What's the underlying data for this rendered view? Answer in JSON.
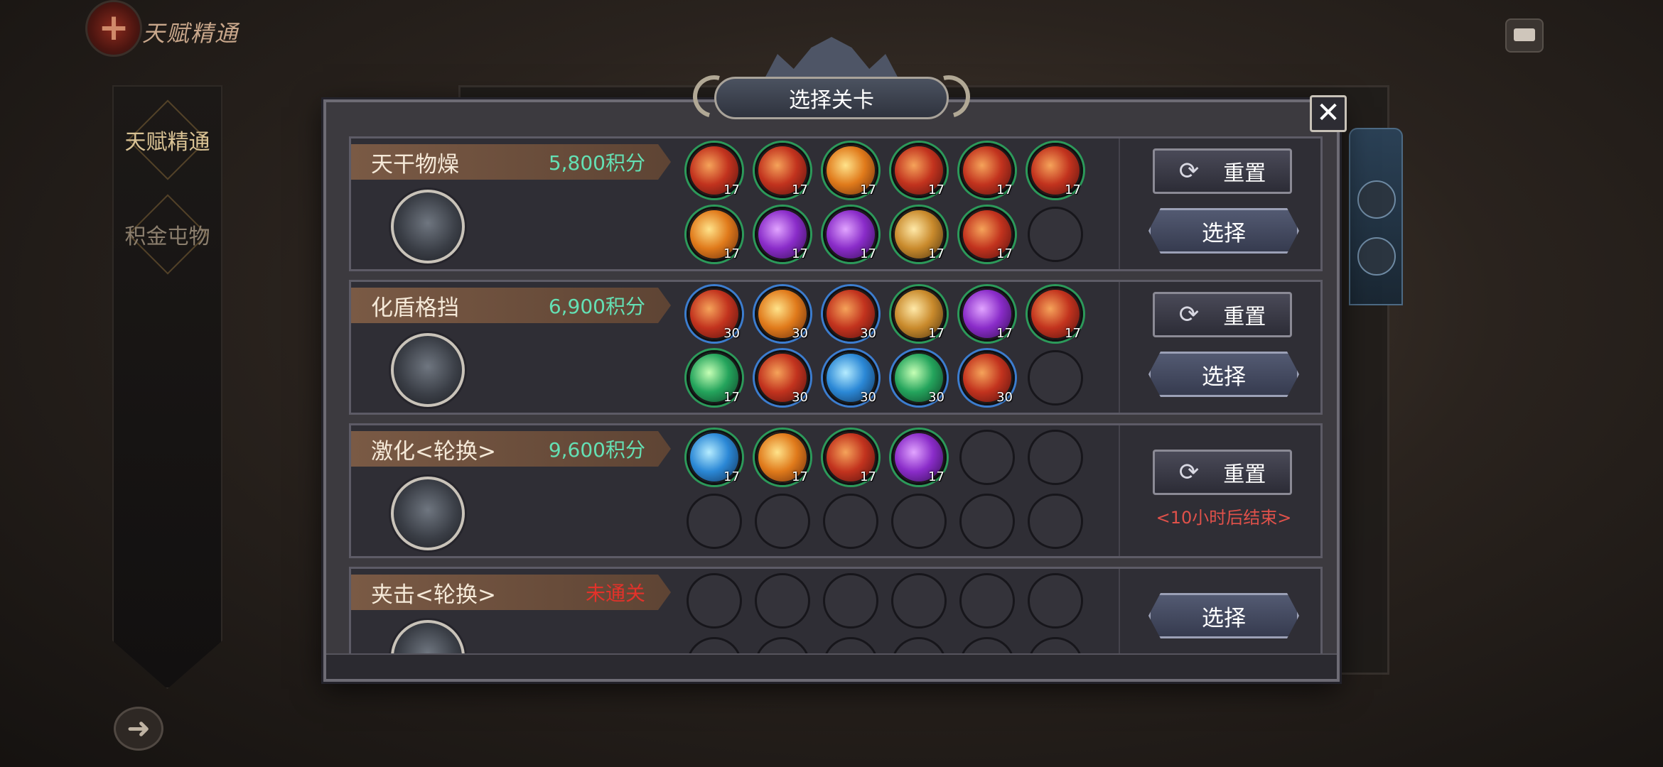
{
  "header": {
    "title": "天赋精通"
  },
  "sidebar": {
    "tabs": [
      {
        "label": "天赋精通",
        "active": true
      },
      {
        "label": "积金屯物",
        "active": false
      }
    ]
  },
  "dialog": {
    "title": "选择关卡",
    "close_label": "✕",
    "rows": [
      {
        "name": "天干物燥",
        "score": "5,800积分",
        "score_color": "#64e0b4",
        "skills_top": [
          {
            "color": "red",
            "level": "17"
          },
          {
            "color": "red",
            "level": "17"
          },
          {
            "color": "orange",
            "level": "17"
          },
          {
            "color": "red",
            "level": "17"
          },
          {
            "color": "red",
            "level": "17"
          },
          {
            "color": "red",
            "level": "17"
          }
        ],
        "skills_bottom": [
          {
            "color": "orange",
            "level": "17"
          },
          {
            "color": "purple",
            "level": "17"
          },
          {
            "color": "purple",
            "level": "17"
          },
          {
            "color": "gold",
            "level": "17"
          },
          {
            "color": "red",
            "level": "17"
          },
          {
            "color": "empty",
            "level": ""
          }
        ],
        "reset_label": "重置",
        "select_label": "选择"
      },
      {
        "name": "化盾格挡",
        "score": "6,900积分",
        "score_color": "#64e0b4",
        "skills_top": [
          {
            "color": "red",
            "level": "30"
          },
          {
            "color": "orange",
            "level": "30"
          },
          {
            "color": "red",
            "level": "30"
          },
          {
            "color": "gold",
            "level": "17"
          },
          {
            "color": "purple",
            "level": "17"
          },
          {
            "color": "red",
            "level": "17"
          }
        ],
        "skills_bottom": [
          {
            "color": "green",
            "level": "17"
          },
          {
            "color": "red",
            "level": "30"
          },
          {
            "color": "blue",
            "level": "30"
          },
          {
            "color": "green",
            "level": "30"
          },
          {
            "color": "red",
            "level": "30"
          },
          {
            "color": "empty",
            "level": ""
          }
        ],
        "reset_label": "重置",
        "select_label": "选择"
      },
      {
        "name": "激化<轮换>",
        "score": "9,600积分",
        "score_color": "#64e0b4",
        "skills_top": [
          {
            "color": "blue",
            "level": "17"
          },
          {
            "color": "orange",
            "level": "17"
          },
          {
            "color": "red",
            "level": "17"
          },
          {
            "color": "purple",
            "level": "17"
          },
          {
            "color": "empty",
            "level": ""
          },
          {
            "color": "empty",
            "level": ""
          }
        ],
        "skills_bottom": [
          {
            "color": "empty",
            "level": ""
          },
          {
            "color": "empty",
            "level": ""
          },
          {
            "color": "empty",
            "level": ""
          },
          {
            "color": "empty",
            "level": ""
          },
          {
            "color": "empty",
            "level": ""
          },
          {
            "color": "empty",
            "level": ""
          }
        ],
        "reset_label": "重置",
        "timer": "<10小时后结束>"
      },
      {
        "name": "夹击<轮换>",
        "score": "未通关",
        "score_color": "#e2322a",
        "skills_top": [
          {
            "color": "empty",
            "level": ""
          },
          {
            "color": "empty",
            "level": ""
          },
          {
            "color": "empty",
            "level": ""
          },
          {
            "color": "empty",
            "level": ""
          },
          {
            "color": "empty",
            "level": ""
          },
          {
            "color": "empty",
            "level": ""
          }
        ],
        "skills_bottom": [
          {
            "color": "empty",
            "level": ""
          },
          {
            "color": "empty",
            "level": ""
          },
          {
            "color": "empty",
            "level": ""
          },
          {
            "color": "empty",
            "level": ""
          },
          {
            "color": "empty",
            "level": ""
          },
          {
            "color": "empty",
            "level": ""
          }
        ],
        "select_label": "选择"
      }
    ]
  },
  "icons": {
    "reset": "refresh-icon",
    "back": "back-arrow-icon",
    "mail": "mail-icon"
  }
}
